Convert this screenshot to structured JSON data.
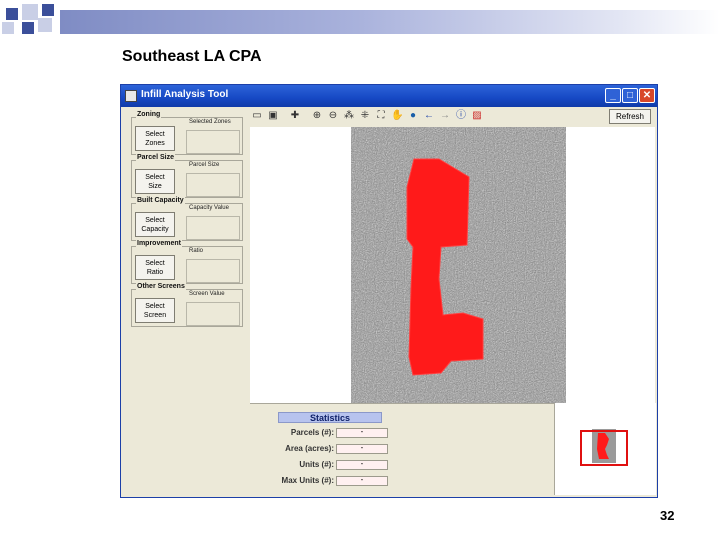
{
  "slide": {
    "title": "Southeast LA CPA",
    "page_number": "32"
  },
  "window": {
    "title": "Infill Analysis Tool",
    "controls": [
      "_",
      "□",
      "✕"
    ]
  },
  "filters": [
    {
      "group": "Zoning",
      "button": "Select\nZones",
      "value_label": "Selected Zones"
    },
    {
      "group": "Parcel Size",
      "button": "Select\nSize",
      "value_label": "Parcel Size"
    },
    {
      "group": "Built Capacity",
      "button": "Select\nCapacity",
      "value_label": "Capacity Value"
    },
    {
      "group": "Improvement",
      "button": "Select\nRatio",
      "value_label": "Ratio"
    },
    {
      "group": "Other Screens",
      "button": "Select\nScreen",
      "value_label": "Screen Value"
    }
  ],
  "toolbar": {
    "icons": [
      "open-icon",
      "save-icon",
      "add-layer-icon",
      "zoom-in-icon",
      "zoom-out-icon",
      "fixed-zoom-in-icon",
      "fixed-zoom-out-icon",
      "full-extent-icon",
      "pan-icon",
      "globe-icon",
      "back-icon",
      "forward-icon",
      "identify-icon",
      "select-icon"
    ],
    "refresh_label": "Refresh"
  },
  "statistics": {
    "title": "Statistics",
    "rows": [
      {
        "label": "Parcels (#):",
        "value": "-"
      },
      {
        "label": "Area (acres):",
        "value": "-"
      },
      {
        "label": "Units (#):",
        "value": "-"
      },
      {
        "label": "Max Units (#):",
        "value": "-"
      }
    ]
  },
  "colors": {
    "title_bar": "#1648c4",
    "highlight": "#ff1a1a",
    "stats_header": "#b7c3ee"
  }
}
